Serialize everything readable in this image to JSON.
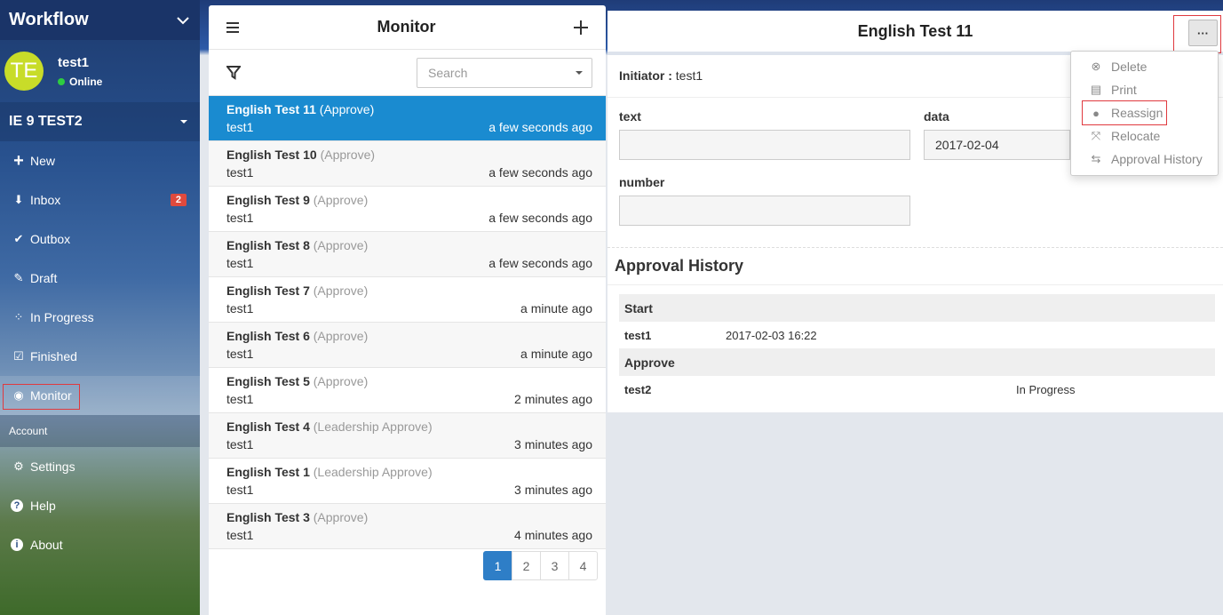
{
  "sidebar": {
    "brand": "Workflow",
    "user": {
      "initials": "TE",
      "name": "test1",
      "status": "Online"
    },
    "org": "IE 9 TEST2",
    "nav": [
      {
        "label": "New",
        "icon": "plus-icon",
        "glyph": "+"
      },
      {
        "label": "Inbox",
        "icon": "inbox-icon",
        "glyph": "⬇",
        "badge": "2"
      },
      {
        "label": "Outbox",
        "icon": "double-check-icon",
        "glyph": "✔"
      },
      {
        "label": "Draft",
        "icon": "edit-icon",
        "glyph": "✎"
      },
      {
        "label": "In Progress",
        "icon": "spinner-icon",
        "glyph": "⁘"
      },
      {
        "label": "Finished",
        "icon": "check-square-icon",
        "glyph": "☑"
      },
      {
        "label": "Monitor",
        "icon": "eye-icon",
        "glyph": "◉"
      }
    ],
    "section_account": "Account",
    "account": [
      {
        "label": "Settings",
        "icon": "gear-icon",
        "glyph": "⚙"
      },
      {
        "label": "Help",
        "icon": "question-icon",
        "glyph": "?"
      },
      {
        "label": "About",
        "icon": "info-icon",
        "glyph": "i"
      }
    ]
  },
  "list": {
    "title": "Monitor",
    "search_placeholder": "Search",
    "items": [
      {
        "title": "English Test 11",
        "stage": "(Approve)",
        "user": "test1",
        "time": "a few seconds ago"
      },
      {
        "title": "English Test 10",
        "stage": "(Approve)",
        "user": "test1",
        "time": "a few seconds ago"
      },
      {
        "title": "English Test 9",
        "stage": "(Approve)",
        "user": "test1",
        "time": "a few seconds ago"
      },
      {
        "title": "English Test 8",
        "stage": "(Approve)",
        "user": "test1",
        "time": "a few seconds ago"
      },
      {
        "title": "English Test 7",
        "stage": "(Approve)",
        "user": "test1",
        "time": "a minute ago"
      },
      {
        "title": "English Test 6",
        "stage": "(Approve)",
        "user": "test1",
        "time": "a minute ago"
      },
      {
        "title": "English Test 5",
        "stage": "(Approve)",
        "user": "test1",
        "time": "2 minutes ago"
      },
      {
        "title": "English Test 4",
        "stage": "(Leadership Approve)",
        "user": "test1",
        "time": "3 minutes ago"
      },
      {
        "title": "English Test 1",
        "stage": "(Leadership Approve)",
        "user": "test1",
        "time": "3 minutes ago"
      },
      {
        "title": "English Test 3",
        "stage": "(Approve)",
        "user": "test1",
        "time": "4 minutes ago"
      }
    ],
    "pages": [
      "1",
      "2",
      "3",
      "4"
    ]
  },
  "detail": {
    "title": "English Test 11",
    "more_label": "···",
    "initiator_label": "Initiator :",
    "initiator_value": "test1",
    "fields": {
      "text_label": "text",
      "text_value": "",
      "data_label": "data",
      "data_value": "2017-02-04",
      "number_label": "number",
      "number_value": ""
    },
    "history_title": "Approval History",
    "history": [
      {
        "group": "Start",
        "who": "test1",
        "when": "2017-02-03 16:22",
        "state": ""
      },
      {
        "group": "Approve",
        "who": "test2",
        "when": "",
        "state": "In Progress"
      }
    ]
  },
  "menu": {
    "items": [
      {
        "label": "Delete",
        "icon": "close-circle-icon",
        "glyph": "⊗"
      },
      {
        "label": "Print",
        "icon": "printer-icon",
        "glyph": "▤"
      },
      {
        "label": "Reassign",
        "icon": "user-icon",
        "glyph": "●"
      },
      {
        "label": "Relocate",
        "icon": "relocate-icon",
        "glyph": "⤧"
      },
      {
        "label": "Approval History",
        "icon": "history-icon",
        "glyph": "⇆"
      }
    ]
  }
}
